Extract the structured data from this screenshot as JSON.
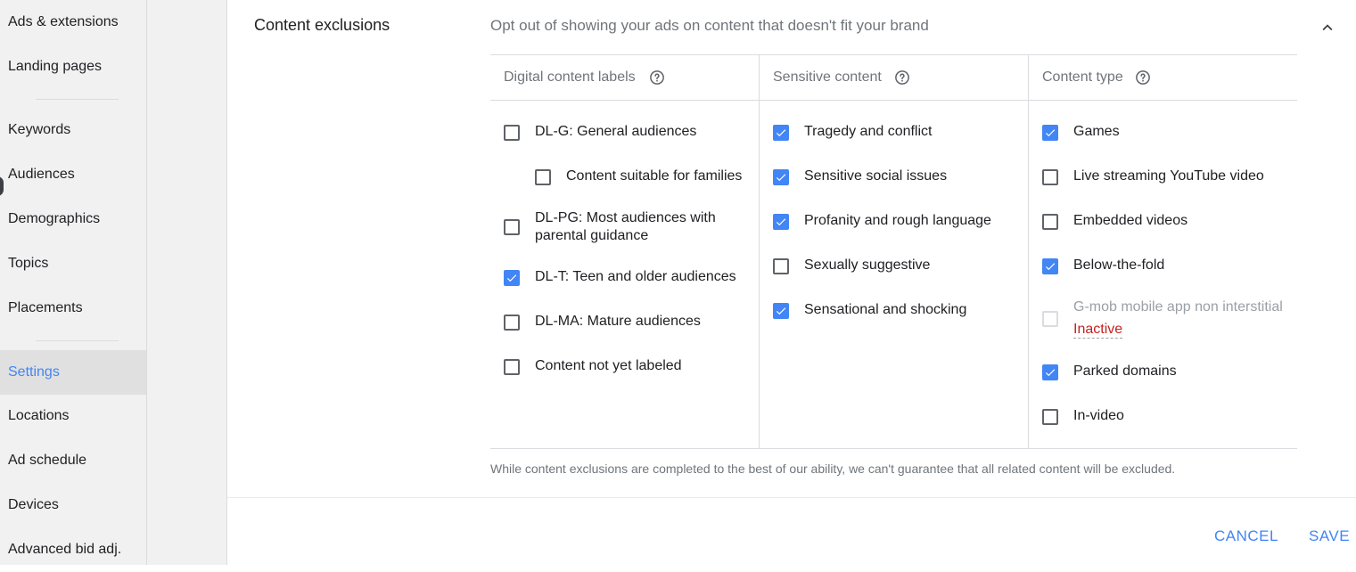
{
  "sidebar": {
    "items": [
      {
        "label": "Ads & extensions"
      },
      {
        "label": "Landing pages"
      },
      {
        "label": "Keywords"
      },
      {
        "label": "Audiences"
      },
      {
        "label": "Demographics"
      },
      {
        "label": "Topics"
      },
      {
        "label": "Placements"
      },
      {
        "label": "Settings",
        "active": true
      },
      {
        "label": "Locations"
      },
      {
        "label": "Ad schedule"
      },
      {
        "label": "Devices"
      },
      {
        "label": "Advanced bid adj."
      }
    ]
  },
  "section": {
    "title": "Content exclusions",
    "description": "Opt out of showing your ads on content that doesn't fit your brand"
  },
  "columns": [
    {
      "header": "Digital content labels",
      "options": [
        {
          "label": "DL-G: General audiences",
          "checked": false
        },
        {
          "label": "Content suitable for families",
          "checked": false
        },
        {
          "label_line1": "DL-PG: Most audiences with",
          "label_line2": "parental guidance",
          "checked": false
        },
        {
          "label": "DL-T: Teen and older audiences",
          "checked": true
        },
        {
          "label": "DL-MA: Mature audiences",
          "checked": false
        },
        {
          "label": "Content not yet labeled",
          "checked": false
        }
      ]
    },
    {
      "header": "Sensitive content",
      "options": [
        {
          "label": "Tragedy and conflict",
          "checked": true
        },
        {
          "label": "Sensitive social issues",
          "checked": true
        },
        {
          "label": "Profanity and rough language",
          "checked": true
        },
        {
          "label": "Sexually suggestive",
          "checked": false
        },
        {
          "label": "Sensational and shocking",
          "checked": true
        }
      ]
    },
    {
      "header": "Content type",
      "options": [
        {
          "label": "Games",
          "checked": true
        },
        {
          "label": "Live streaming YouTube video",
          "checked": false
        },
        {
          "label": "Embedded videos",
          "checked": false
        },
        {
          "label": "Below-the-fold",
          "checked": true
        },
        {
          "label": "G-mob mobile app non interstitial",
          "status": "Inactive",
          "checked": false,
          "disabled": true
        },
        {
          "label": "Parked domains",
          "checked": true
        },
        {
          "label": "In-video",
          "checked": false
        }
      ]
    }
  ],
  "disclaimer": "While content exclusions are completed to the best of our ability, we can't guarantee that all related content will be excluded.",
  "actions": {
    "cancel": "CANCEL",
    "save": "SAVE"
  },
  "colors": {
    "accent": "#4285f4",
    "inactive": "#c5221f",
    "sidebar_bg": "#f1f1f1"
  },
  "icons": {
    "help": "help-circle-icon",
    "collapse": "chevron-up-icon",
    "checkmark": "check-icon"
  }
}
